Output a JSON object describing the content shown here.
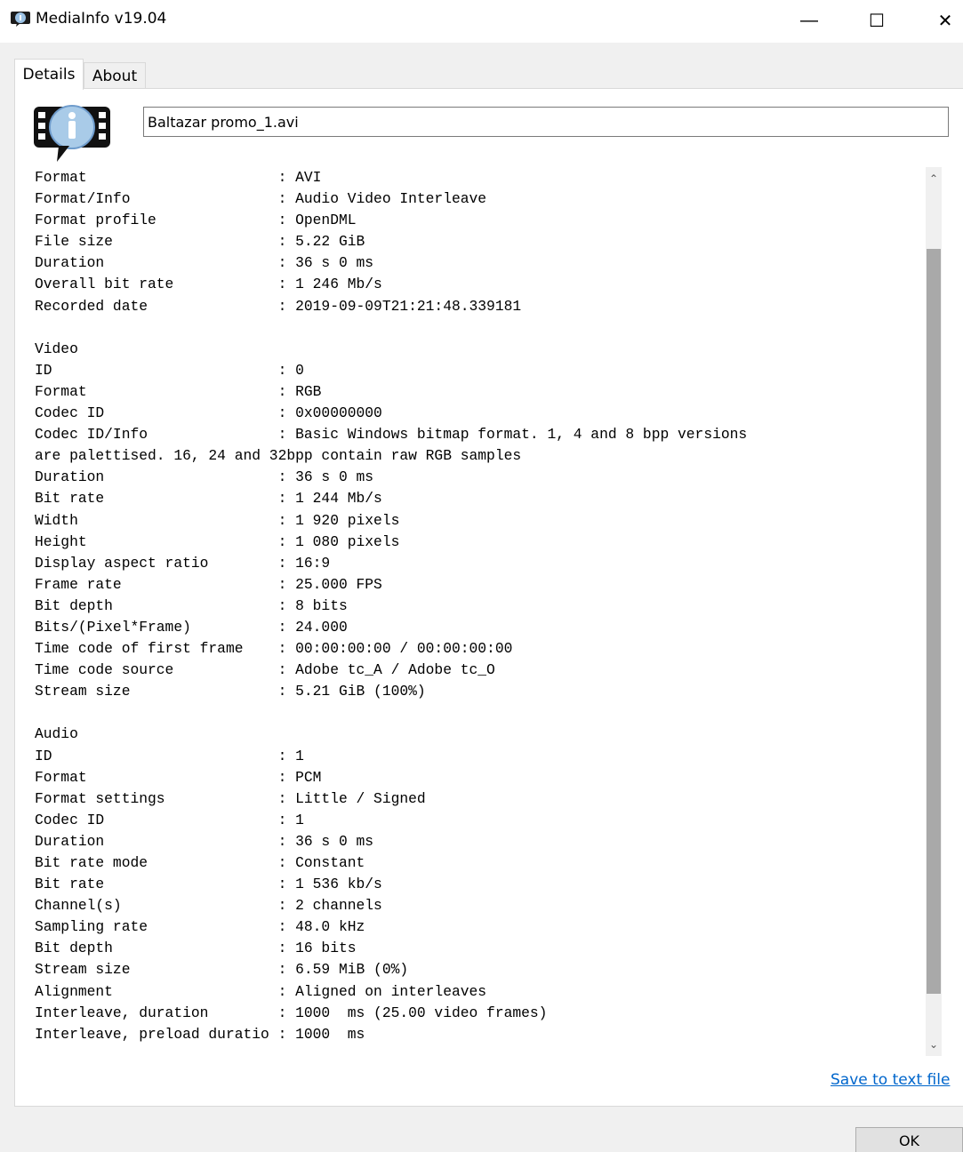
{
  "window": {
    "title": "MediaInfo v19.04",
    "minimize_glyph": "—",
    "maximize_glyph": "☐",
    "close_glyph": "✕"
  },
  "tabs": [
    {
      "label": "Details",
      "selected": true
    },
    {
      "label": "About",
      "selected": false
    }
  ],
  "file": {
    "name": "Baltazar promo_1.avi"
  },
  "info_lines": [
    "Format                      : AVI",
    "Format/Info                 : Audio Video Interleave",
    "Format profile              : OpenDML",
    "File size                   : 5.22 GiB",
    "Duration                    : 36 s 0 ms",
    "Overall bit rate            : 1 246 Mb/s",
    "Recorded date               : 2019-09-09T21:21:48.339181",
    "",
    "Video",
    "ID                          : 0",
    "Format                      : RGB",
    "Codec ID                    : 0x00000000",
    "Codec ID/Info               : Basic Windows bitmap format. 1, 4 and 8 bpp versions",
    "are palettised. 16, 24 and 32bpp contain raw RGB samples",
    "Duration                    : 36 s 0 ms",
    "Bit rate                    : 1 244 Mb/s",
    "Width                       : 1 920 pixels",
    "Height                      : 1 080 pixels",
    "Display aspect ratio        : 16:9",
    "Frame rate                  : 25.000 FPS",
    "Bit depth                   : 8 bits",
    "Bits/(Pixel*Frame)          : 24.000",
    "Time code of first frame    : 00:00:00:00 / 00:00:00:00",
    "Time code source            : Adobe tc_A / Adobe tc_O",
    "Stream size                 : 5.21 GiB (100%)",
    "",
    "Audio",
    "ID                          : 1",
    "Format                      : PCM",
    "Format settings             : Little / Signed",
    "Codec ID                    : 1",
    "Duration                    : 36 s 0 ms",
    "Bit rate mode               : Constant",
    "Bit rate                    : 1 536 kb/s",
    "Channel(s)                  : 2 channels",
    "Sampling rate               : 48.0 kHz",
    "Bit depth                   : 16 bits",
    "Stream size                 : 6.59 MiB (0%)",
    "Alignment                   : Aligned on interleaves",
    "Interleave, duration        : 1000  ms (25.00 video frames)",
    "Interleave, preload duratio : 1000  ms"
  ],
  "scrollbar": {
    "up_glyph": "⌃",
    "down_glyph": "⌄"
  },
  "actions": {
    "save_link": "Save to text file",
    "ok_button": "OK"
  }
}
